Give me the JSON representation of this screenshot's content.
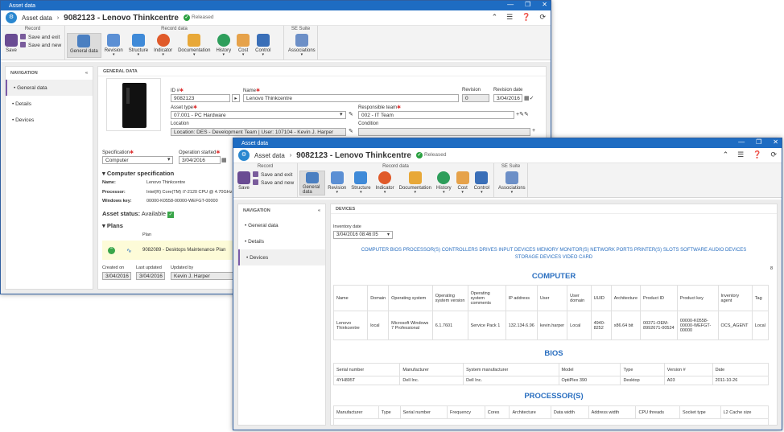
{
  "w1": {
    "title": "Asset data",
    "breadcrumb": "Asset data",
    "record": "9082123 - Lenovo Thinkcentre",
    "status": "Released",
    "ribbon": {
      "record_group": "Record",
      "record_data_group": "Record data",
      "suite_group": "SE Suite",
      "save": "Save",
      "save_exit": "Save and exit",
      "save_new": "Save and new",
      "buttons": [
        "General data",
        "Revision",
        "Structure",
        "Indicator",
        "Documentation",
        "History",
        "Cost",
        "Control"
      ],
      "associations": "Associations"
    },
    "nav": {
      "title": "NAVIGATION",
      "items": [
        "General data",
        "Details",
        "Devices"
      ]
    },
    "main_title": "GENERAL DATA",
    "fields": {
      "id_label": "ID #",
      "id": "9082123",
      "name_label": "Name",
      "name": "Lenovo Thinkcentre",
      "revision_label": "Revision",
      "revision": "0",
      "revdate_label": "Revision date",
      "revdate": "3/04/2016",
      "type_label": "Asset type",
      "type": "07.001 - PC Hardware",
      "team_label": "Responsible team",
      "team": "002 - IT Team",
      "location_label": "Location",
      "location": "Location: DES - Development Team | User: 107104 - Kevin J. Harper",
      "condition_label": "Condition",
      "condition": "",
      "spec_label": "Specification",
      "spec": "Computer",
      "opstart_label": "Operation started",
      "opstart": "3/04/2016"
    },
    "spec_title": "Computer specification",
    "spec_rows": [
      [
        "Name:",
        "Lenovo Thinkcentre"
      ],
      [
        "Processor:",
        "Intel(R) Core(TM) i7-2120 CPU @ 4.70GHz"
      ],
      [
        "Windows key:",
        "00000-K0558-00000-WEFGT-00000"
      ]
    ],
    "asset_status_label": "Asset status:",
    "asset_status": "Available",
    "plans_title": "Plans",
    "plan_col": "Plan",
    "plan": "9082089 - Desktops Maintenance Plan",
    "created_label": "Created on",
    "created": "3/04/2016",
    "updated_label": "Last updated",
    "updated": "3/04/2016",
    "updatedby_label": "Updated by",
    "updatedby": "Kevin J. Harper"
  },
  "w2": {
    "title": "Asset data",
    "breadcrumb": "Asset data",
    "record": "9082123 - Lenovo Thinkcentre",
    "status": "Released",
    "nav": {
      "title": "NAVIGATION",
      "items": [
        "General data",
        "Details",
        "Devices"
      ]
    },
    "main_title": "DEVICES",
    "inv_label": "Inventory date",
    "inv_date": "3/04/2016 08:46:05",
    "tabs_line1": "COMPUTER   BIOS   PROCESSOR(S)   CONTROLLERS   DRIVES   INPUT DEVICES   MEMORY   MONITOR(S)   NETWORK   PORTS   PRINTER(S)   SLOTS   SOFTWARE   AUDIO DEVICES",
    "tabs_line2": "STORAGE DEVICES   VIDEO CARD",
    "count": "8",
    "computer_title": "COMPUTER",
    "computer_head": [
      "Name",
      "Domain",
      "Operating system",
      "Operating system version",
      "Operating system comments",
      "IP address",
      "User",
      "User domain",
      "UUID",
      "Architecture",
      "Product ID",
      "Product key",
      "Inventory agent",
      "Tag"
    ],
    "computer_row": [
      "Lenovo Thinkcentre",
      "local",
      "Microsoft Windows 7 Professional",
      "6.1.7601",
      "Service Pack 1",
      "132.134.6.96",
      "kevin.harper",
      "Local",
      "4940-8252",
      "x86.64 bit",
      "00371-OEM-8992671-00524",
      "00000-K0558-00000-WEFGT-00000",
      "OCS_AGENT",
      "Local"
    ],
    "bios_title": "BIOS",
    "bios_head": [
      "Serial number",
      "Manufacturer",
      "System manufacturer",
      "Model",
      "Type",
      "Version #",
      "Date"
    ],
    "bios_row": [
      "4YH895T",
      "Dell Inc.",
      "Dell Inc.",
      "OptiPlex 390",
      "Desktop",
      "A03",
      "2011-10-26"
    ],
    "proc_title": "PROCESSOR(S)",
    "proc_head": [
      "Manufacturer",
      "Type",
      "Serial number",
      "Frequency",
      "Cores",
      "Architecture",
      "Data width",
      "Address width",
      "CPU threads",
      "Socket type",
      "L2 Cache size"
    ]
  }
}
